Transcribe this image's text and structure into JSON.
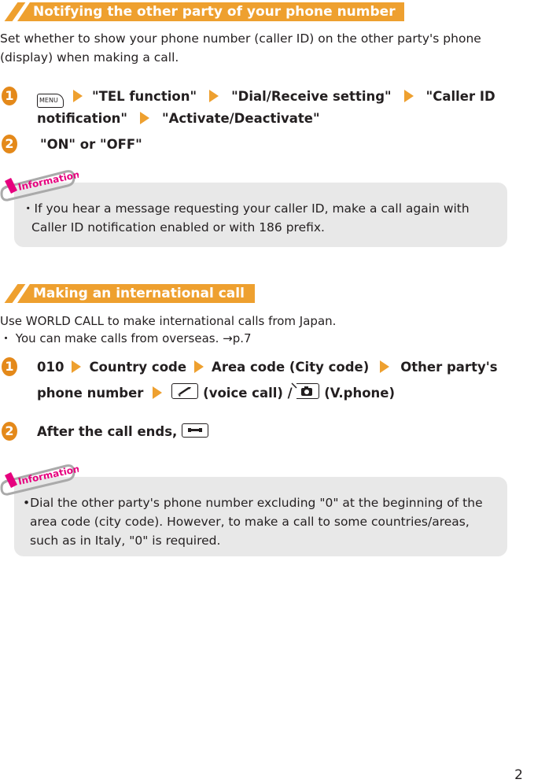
{
  "section1": {
    "title": "Notifying the other party of your phone number",
    "intro_line1": "Set whether to show your phone number (caller ID) on the other party's phone",
    "intro_line2": "(display) when making a call.",
    "steps": [
      {
        "number": "1",
        "menu_key_label": "MENU",
        "parts": [
          "\"TEL function\"",
          "\"Dial/Receive setting\"",
          "\"Caller ID",
          "notification\"",
          "\"Activate/Deactivate\""
        ]
      },
      {
        "number": "2",
        "text": "\"ON\" or \"OFF\""
      }
    ],
    "info": {
      "tag": "Information",
      "line1": "・If you hear a message requesting your caller ID, make a call again with",
      "line2": "Caller ID notification enabled or with 186 prefix."
    }
  },
  "section2": {
    "title": "Making an international call",
    "intro": "Use WORLD CALL to make international calls from Japan.",
    "bullet": "・ You can make calls from overseas. →p.7",
    "steps": [
      {
        "number": "1",
        "parts": [
          "010",
          "Country code",
          "Area code (City code)",
          "Other party's",
          "phone number"
        ],
        "voice_label": "(voice call) /",
        "vphone_label": "(V.phone)"
      },
      {
        "number": "2",
        "text": "After the call ends,"
      }
    ],
    "info": {
      "tag": "Information",
      "line1": "•Dial the other party's phone number excluding \"0\" at the beginning of the",
      "line2": "area code (city code). However, to make a call to some countries/areas,",
      "line3": "such as in Italy, \"0\" is required."
    }
  },
  "colors": {
    "accent_orange": "#eea02f",
    "step_orange": "#e4891a",
    "info_pink": "#e6007e",
    "info_bg": "#e8e8e8"
  },
  "page_number": "2"
}
